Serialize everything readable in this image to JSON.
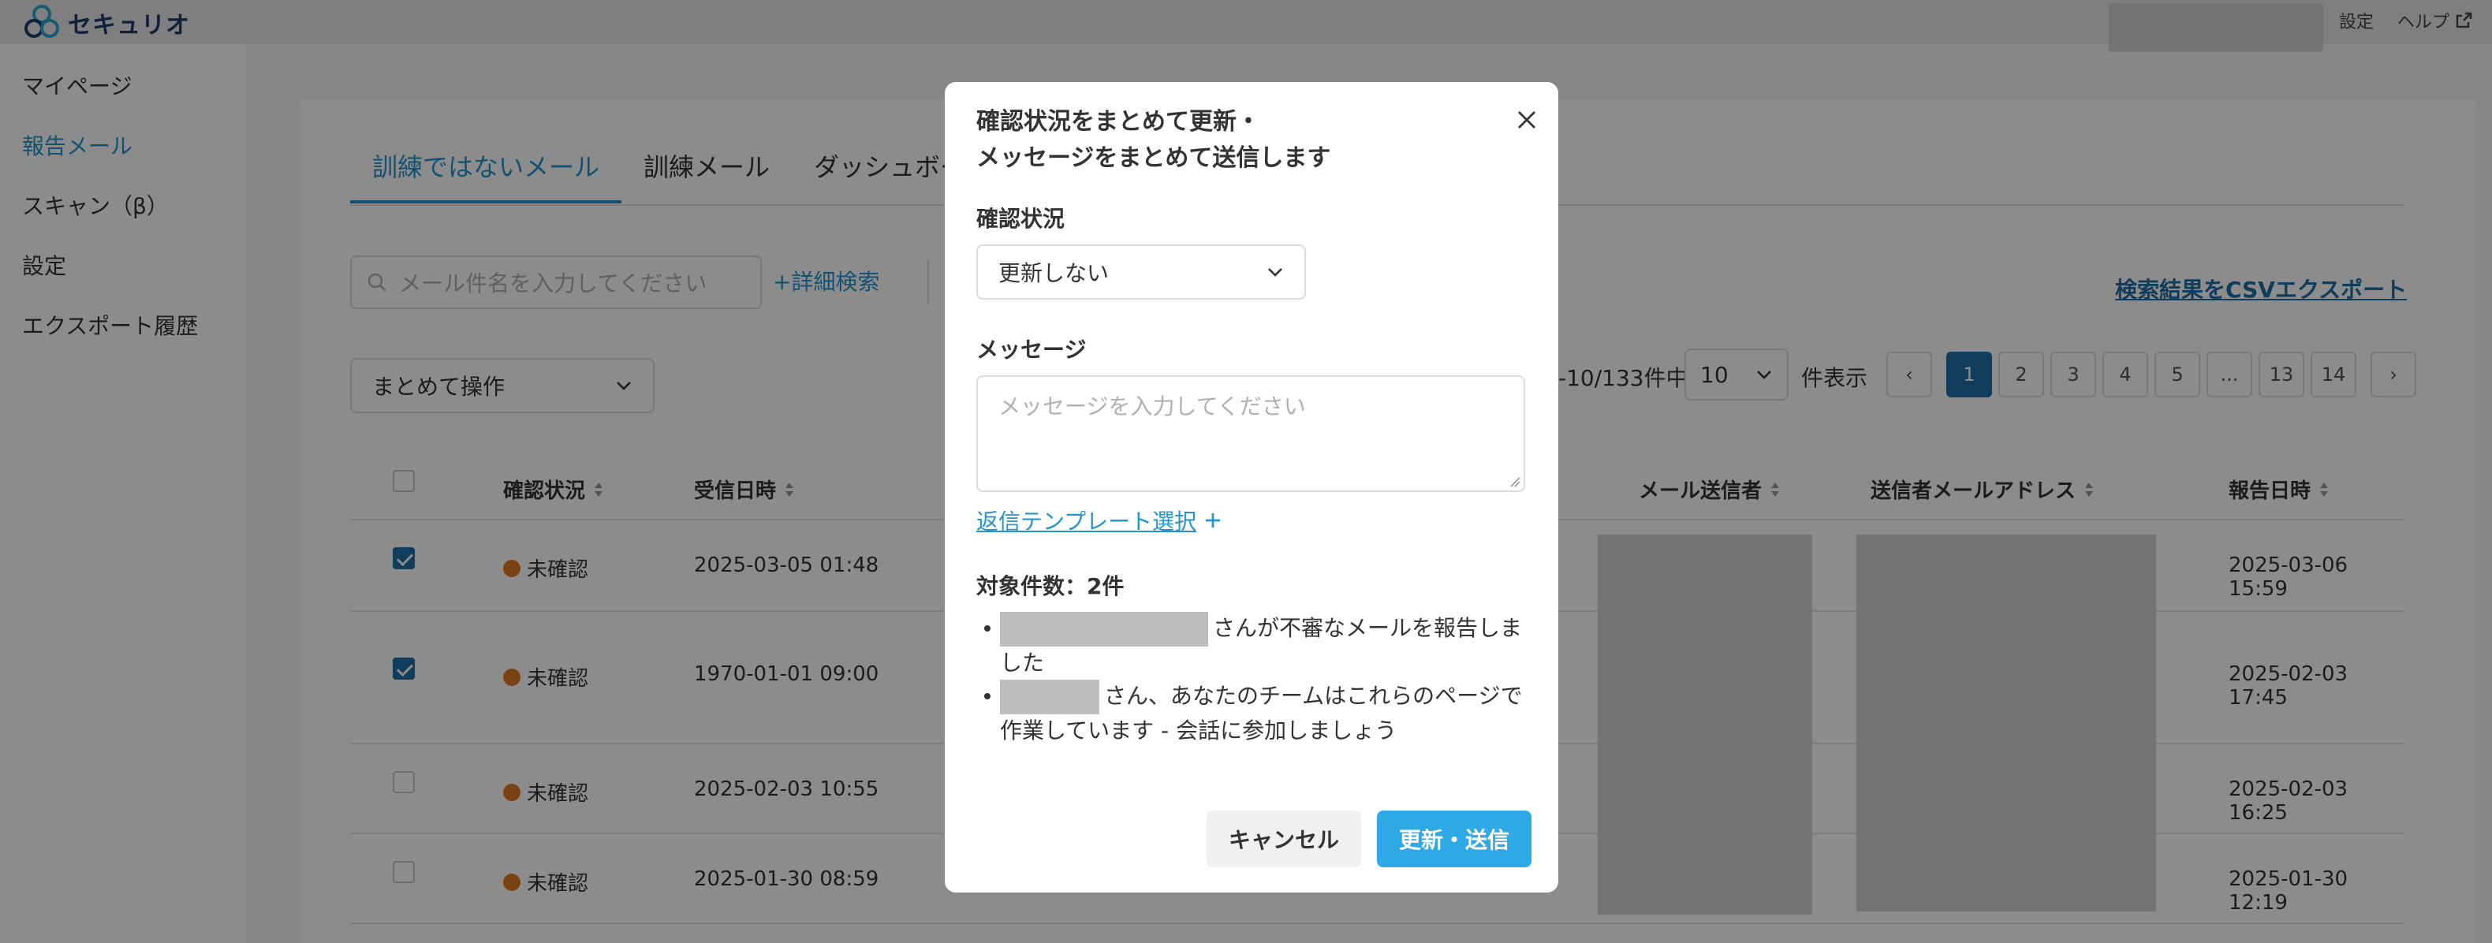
{
  "app": {
    "logo_text": "セキュリオ"
  },
  "topbar": {
    "settings": "設定",
    "help": "ヘルプ"
  },
  "sidebar": {
    "items": [
      {
        "label": "マイページ",
        "active": false
      },
      {
        "label": "報告メール",
        "active": true
      },
      {
        "label": "スキャン（β）",
        "active": false
      },
      {
        "label": "設定",
        "active": false
      },
      {
        "label": "エクスポート履歴",
        "active": false
      }
    ]
  },
  "tabs": [
    {
      "label": "訓練ではないメール",
      "active": true
    },
    {
      "label": "訓練メール",
      "active": false
    },
    {
      "label": "ダッシュボー",
      "active": false
    }
  ],
  "search": {
    "placeholder": "メール件名を入力してください",
    "advanced": "詳細検索"
  },
  "csv_export": "検索結果をCSVエクスポート",
  "bulk_action": {
    "selected": "まとめて操作"
  },
  "pager": {
    "range": "-10/133件中",
    "page_size": "10",
    "page_size_label": "件表示",
    "prev": "‹",
    "next": "›",
    "pages": [
      "1",
      "2",
      "3",
      "4",
      "5",
      "...",
      "13",
      "14"
    ],
    "current": "1"
  },
  "table": {
    "columns": {
      "status": "確認状況",
      "received": "受信日時",
      "sender": "メール送信者",
      "sender_address": "送信者メールアドレス",
      "reported": "報告日時"
    },
    "rows": [
      {
        "checked": true,
        "status": "未確認",
        "received": "2025-03-05 01:48",
        "reported": "2025-03-06 15:59"
      },
      {
        "checked": true,
        "status": "未確認",
        "received": "1970-01-01 09:00",
        "reported": "2025-02-03 17:45"
      },
      {
        "checked": false,
        "status": "未確認",
        "received": "2025-02-03 10:55",
        "reported": "2025-02-03 16:25"
      },
      {
        "checked": false,
        "status": "未確認",
        "received": "2025-01-30 08:59",
        "reported": "2025-01-30 12:19"
      }
    ]
  },
  "modal": {
    "title_line1": "確認状況をまとめて更新・",
    "title_line2": "メッセージをまとめて送信します",
    "status_label": "確認状況",
    "status_value": "更新しない",
    "message_label": "メッセージ",
    "message_placeholder": "メッセージを入力してください",
    "template_link": "返信テンプレート選択",
    "target_count": "対象件数：2件",
    "targets": [
      {
        "text1": "さんが不審なメールを報告しま",
        "text2": "した"
      },
      {
        "text1": "さん、あなたのチームはこれらのページで",
        "text2": "作業しています - 会話に参加しましょう"
      }
    ],
    "cancel": "キャンセル",
    "submit": "更新・送信"
  },
  "colors": {
    "accent": "#2496cf",
    "primary_dark": "#1e6fa8",
    "status_unconfirmed": "#e07b1f",
    "submit": "#2fa9e6"
  }
}
